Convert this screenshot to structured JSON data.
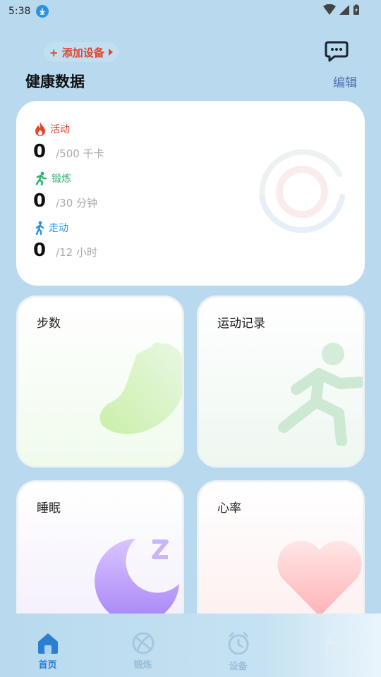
{
  "status_bar": {
    "time": "5:38"
  },
  "header": {
    "add_device": "+ 添加设备",
    "section_title": "健康数据",
    "edit": "编辑"
  },
  "summary": {
    "metrics": [
      {
        "label": "活动",
        "value": "0",
        "goal": "/500 千卡",
        "color": "#e0452f"
      },
      {
        "label": "锻炼",
        "value": "0",
        "goal": "/30 分钟",
        "color": "#2fb46e"
      },
      {
        "label": "走动",
        "value": "0",
        "goal": "/12 小时",
        "color": "#2b92e8"
      }
    ]
  },
  "tiles": {
    "steps": "步数",
    "exercise_records": "运动记录",
    "sleep": "睡眠",
    "heart_rate": "心率"
  },
  "bottom_nav": {
    "items": [
      {
        "label": "首页",
        "icon": "home-icon",
        "active": true
      },
      {
        "label": "锻炼",
        "icon": "ball-icon",
        "active": false
      },
      {
        "label": "设备",
        "icon": "watch-icon",
        "active": false
      },
      {
        "label": "",
        "icon": "lock-icon",
        "active": false
      }
    ]
  }
}
